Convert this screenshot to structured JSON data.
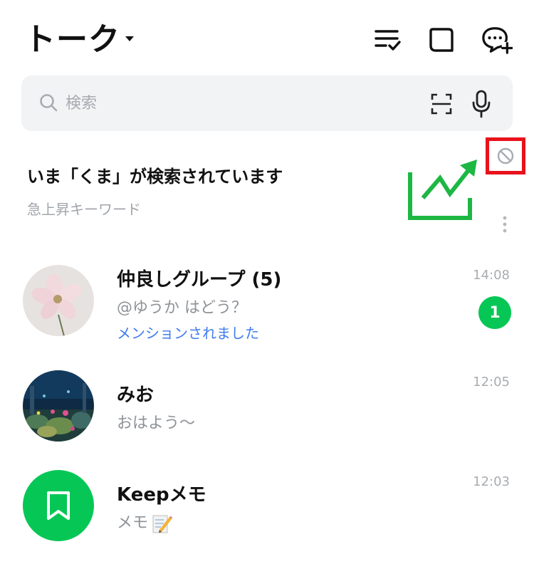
{
  "header": {
    "title": "トーク"
  },
  "search": {
    "placeholder": "検索"
  },
  "trending": {
    "title": "いま「くま」が検索されています",
    "subtitle": "急上昇キーワード"
  },
  "chats": [
    {
      "name": "仲良しグループ (5)",
      "message": "@ゆうか はどう？",
      "mention": "メンションされました",
      "time": "14:08",
      "unread": "1",
      "avatar": "flower-photo"
    },
    {
      "name": "みお",
      "message": "おはよう〜",
      "time": "12:05",
      "avatar": "aquarium-photo"
    },
    {
      "name": "Keepメモ",
      "message": "メモ",
      "time": "12:03",
      "avatar": "bookmark-icon"
    }
  ],
  "colors": {
    "accent": "#06c755",
    "mention": "#3d7bf0",
    "highlight": "#e8121c",
    "arrow": "#1db744"
  }
}
